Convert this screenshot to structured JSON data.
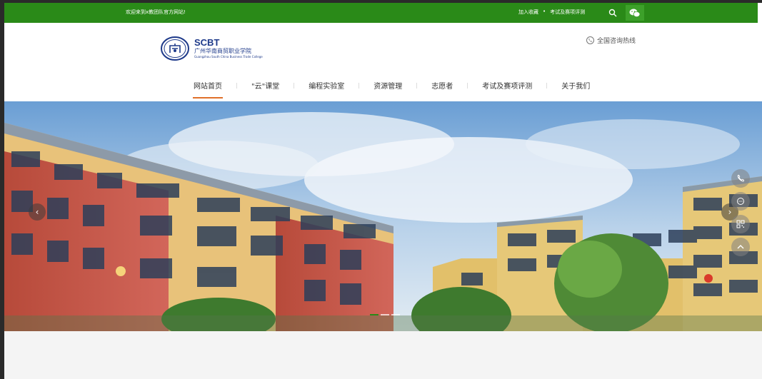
{
  "topbar": {
    "welcome": "欢迎来到x教团队官方网站!",
    "bookmark": "加入收藏",
    "separator": "•",
    "exam_link": "考试及赛项评测"
  },
  "logo": {
    "brand_en": "SCBT",
    "brand_cn": "广州华南商贸职业学院",
    "brand_sub": "Guangzhou South China Business Trade College"
  },
  "header": {
    "hotline": "全国咨询热线"
  },
  "nav": {
    "items": [
      {
        "label": "网站首页"
      },
      {
        "label": "\"云\"课堂"
      },
      {
        "label": "编程实验室"
      },
      {
        "label": "资源管理"
      },
      {
        "label": "志愿者"
      },
      {
        "label": "考试及赛项评测"
      },
      {
        "label": "关于我们"
      }
    ],
    "active_index": 0
  },
  "hero": {
    "prev": "‹",
    "next": "›",
    "slides_count": 3,
    "active_slide": 0
  },
  "side_float": {
    "icons": [
      "phone-icon",
      "chat-icon",
      "qrcode-icon",
      "back-to-top-icon"
    ]
  },
  "colors": {
    "topbar_green": "#2a8a18",
    "accent_orange": "#e0702a",
    "brand_blue": "#1e3a8a"
  }
}
